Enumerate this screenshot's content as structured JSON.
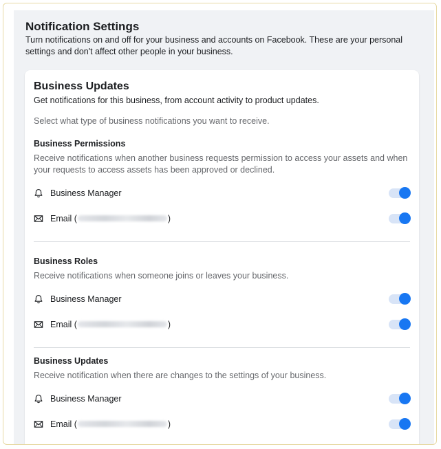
{
  "page": {
    "title": "Notification Settings",
    "description": "Turn notifications on and off for your business and accounts on Facebook. These are your personal settings and don't affect other people in your business."
  },
  "card": {
    "title": "Business Updates",
    "subtitle": "Get notifications for this business, from account activity to product updates.",
    "prompt": "Select what type of business notifications you want to receive."
  },
  "sections": [
    {
      "title": "Business Permissions",
      "description": "Receive notifications when another business requests permission to access your assets and when your requests to access assets has been approved or declined.",
      "rows": [
        {
          "icon": "bell-icon",
          "label": "Business Manager",
          "enabled": true
        },
        {
          "icon": "envelope-icon",
          "label_prefix": "Email (",
          "label_suffix": ")",
          "enabled": true
        }
      ]
    },
    {
      "title": "Business Roles",
      "description": "Receive notifications when someone joins or leaves your business.",
      "rows": [
        {
          "icon": "bell-icon",
          "label": "Business Manager",
          "enabled": true
        },
        {
          "icon": "envelope-icon",
          "label_prefix": "Email (",
          "label_suffix": ")",
          "enabled": true
        }
      ]
    },
    {
      "title": "Business Updates",
      "description": "Receive notification when there are changes to the settings of your business.",
      "rows": [
        {
          "icon": "bell-icon",
          "label": "Business Manager",
          "enabled": true
        },
        {
          "icon": "envelope-icon",
          "label_prefix": "Email (",
          "label_suffix": ")",
          "enabled": true
        }
      ]
    }
  ],
  "colors": {
    "accent": "#1877f2",
    "toggle_track": "#d8e4f7",
    "page_bg": "#f0f2f5"
  }
}
